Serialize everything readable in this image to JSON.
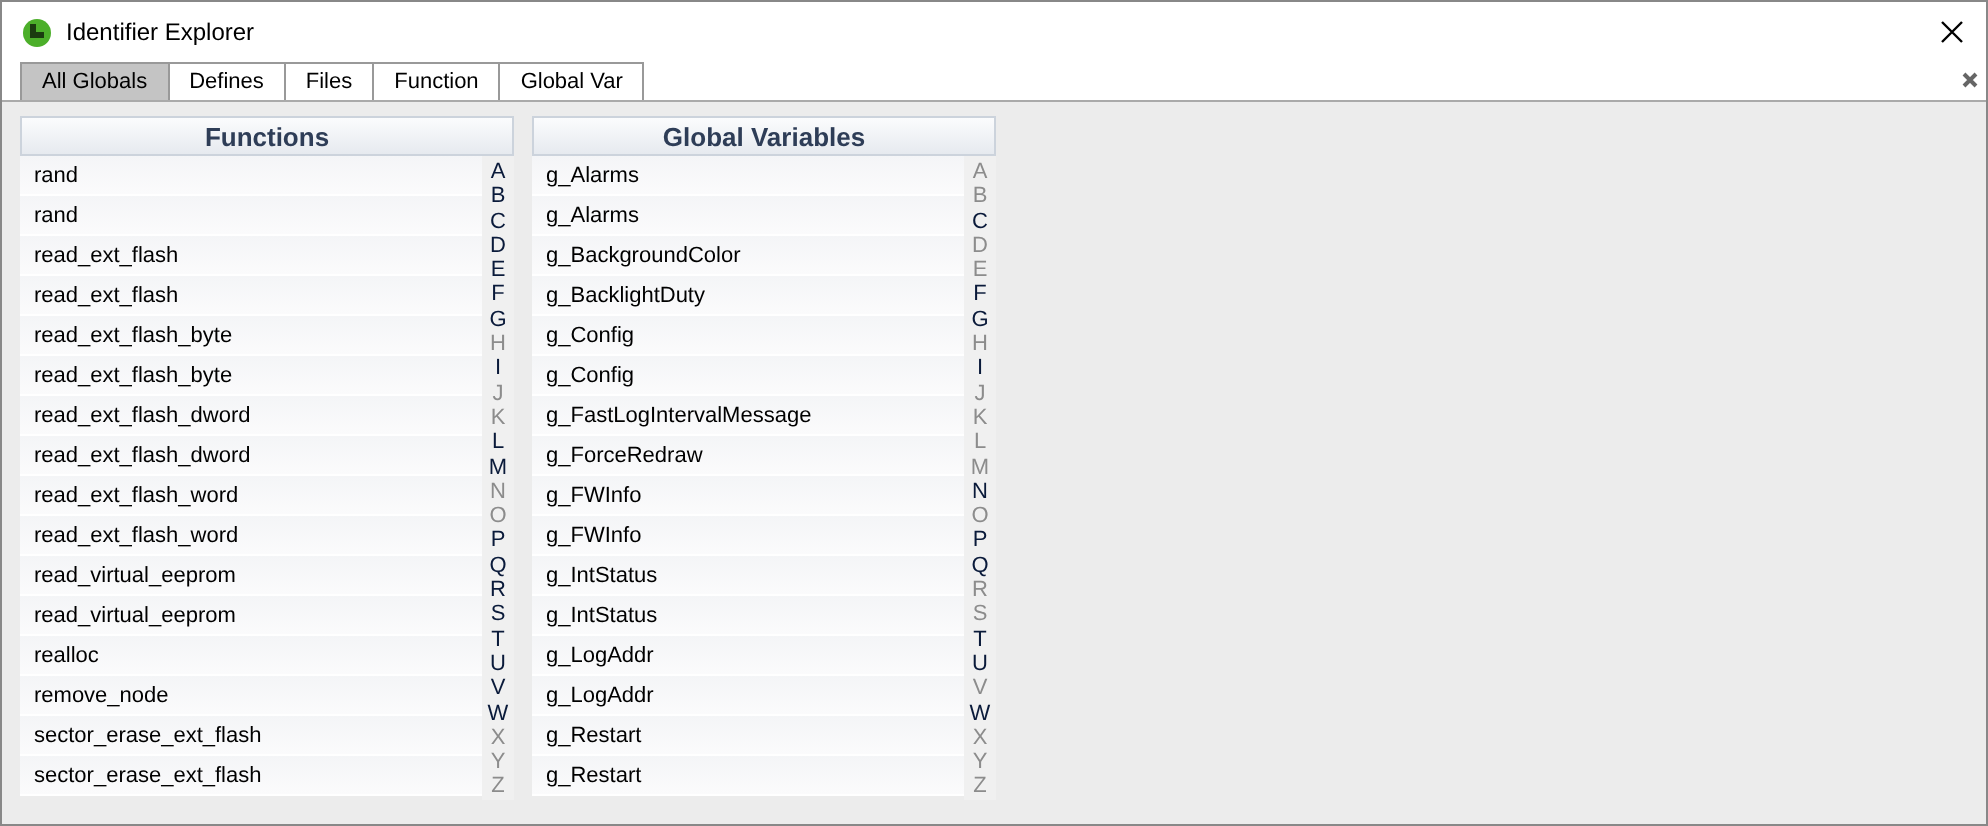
{
  "window": {
    "title": "Identifier Explorer"
  },
  "tabs": [
    {
      "label": "All Globals",
      "selected": true
    },
    {
      "label": "Defines",
      "selected": false
    },
    {
      "label": "Files",
      "selected": false
    },
    {
      "label": "Function",
      "selected": false
    },
    {
      "label": "Global Var",
      "selected": false
    }
  ],
  "panels": [
    {
      "title": "Functions",
      "items": [
        "rand",
        "rand",
        "read_ext_flash",
        "read_ext_flash",
        "read_ext_flash_byte",
        "read_ext_flash_byte",
        "read_ext_flash_dword",
        "read_ext_flash_dword",
        "read_ext_flash_word",
        "read_ext_flash_word",
        "read_virtual_eeprom",
        "read_virtual_eeprom",
        "realloc",
        "remove_node",
        "sector_erase_ext_flash",
        "sector_erase_ext_flash"
      ],
      "index": [
        {
          "letter": "A",
          "disabled": false
        },
        {
          "letter": "B",
          "disabled": false
        },
        {
          "letter": "C",
          "disabled": false
        },
        {
          "letter": "D",
          "disabled": false
        },
        {
          "letter": "E",
          "disabled": false
        },
        {
          "letter": "F",
          "disabled": false
        },
        {
          "letter": "G",
          "disabled": false
        },
        {
          "letter": "H",
          "disabled": true
        },
        {
          "letter": "I",
          "disabled": false
        },
        {
          "letter": "J",
          "disabled": true
        },
        {
          "letter": "K",
          "disabled": true
        },
        {
          "letter": "L",
          "disabled": false
        },
        {
          "letter": "M",
          "disabled": false
        },
        {
          "letter": "N",
          "disabled": true
        },
        {
          "letter": "O",
          "disabled": true
        },
        {
          "letter": "P",
          "disabled": false
        },
        {
          "letter": "Q",
          "disabled": false
        },
        {
          "letter": "R",
          "disabled": false
        },
        {
          "letter": "S",
          "disabled": false
        },
        {
          "letter": "T",
          "disabled": false
        },
        {
          "letter": "U",
          "disabled": false
        },
        {
          "letter": "V",
          "disabled": false
        },
        {
          "letter": "W",
          "disabled": false
        },
        {
          "letter": "X",
          "disabled": true
        },
        {
          "letter": "Y",
          "disabled": true
        },
        {
          "letter": "Z",
          "disabled": true
        }
      ]
    },
    {
      "title": "Global Variables",
      "items": [
        "g_Alarms",
        "g_Alarms",
        "g_BackgroundColor",
        "g_BacklightDuty",
        "g_Config",
        "g_Config",
        "g_FastLogIntervalMessage",
        "g_ForceRedraw",
        "g_FWInfo",
        "g_FWInfo",
        "g_IntStatus",
        "g_IntStatus",
        "g_LogAddr",
        "g_LogAddr",
        "g_Restart",
        "g_Restart"
      ],
      "index": [
        {
          "letter": "A",
          "disabled": true
        },
        {
          "letter": "B",
          "disabled": true
        },
        {
          "letter": "C",
          "disabled": false
        },
        {
          "letter": "D",
          "disabled": true
        },
        {
          "letter": "E",
          "disabled": true
        },
        {
          "letter": "F",
          "disabled": false
        },
        {
          "letter": "G",
          "disabled": false
        },
        {
          "letter": "H",
          "disabled": true
        },
        {
          "letter": "I",
          "disabled": false
        },
        {
          "letter": "J",
          "disabled": true
        },
        {
          "letter": "K",
          "disabled": true
        },
        {
          "letter": "L",
          "disabled": true
        },
        {
          "letter": "M",
          "disabled": true
        },
        {
          "letter": "N",
          "disabled": false
        },
        {
          "letter": "O",
          "disabled": true
        },
        {
          "letter": "P",
          "disabled": false
        },
        {
          "letter": "Q",
          "disabled": false
        },
        {
          "letter": "R",
          "disabled": true
        },
        {
          "letter": "S",
          "disabled": true
        },
        {
          "letter": "T",
          "disabled": false
        },
        {
          "letter": "U",
          "disabled": false
        },
        {
          "letter": "V",
          "disabled": true
        },
        {
          "letter": "W",
          "disabled": false
        },
        {
          "letter": "X",
          "disabled": true
        },
        {
          "letter": "Y",
          "disabled": true
        },
        {
          "letter": "Z",
          "disabled": true
        }
      ]
    }
  ]
}
